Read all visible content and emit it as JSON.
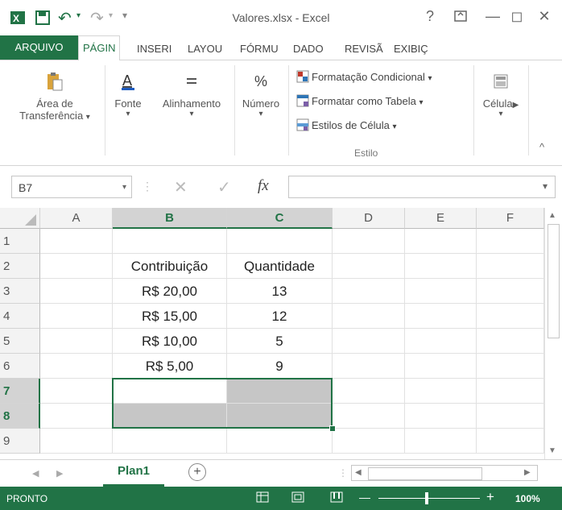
{
  "window": {
    "title": "Valores.xlsx - Excel",
    "help": "?",
    "minimize": "—",
    "maximize": "◻",
    "close": "✕"
  },
  "quick_access": {
    "save_icon": "save-icon",
    "undo_icon": "undo-icon",
    "redo_icon": "redo-icon",
    "customize": "▾"
  },
  "tabs": [
    "ARQUIVO",
    "PÁGIN",
    "INSERI",
    "LAYOU",
    "FÓRMU",
    "DADO",
    "REVISÃ",
    "EXIBIÇ"
  ],
  "ribbon": {
    "clipboard": {
      "line1": "Área de",
      "line2": "Transferência",
      "arrow": "▾"
    },
    "font": {
      "label": "Fonte",
      "arrow": "▾"
    },
    "alignment": {
      "label": "Alinhamento",
      "arrow": "▾"
    },
    "number": {
      "label": "Número",
      "arrow": "▾"
    },
    "styles": {
      "conditional": "Formatação Condicional",
      "table": "Formatar como Tabela",
      "cell_styles": "Estilos de Célula",
      "group_label": "Estilo"
    },
    "cells": {
      "label": "Célula",
      "arrow": "▾"
    },
    "collapse": "^"
  },
  "formula_bar": {
    "name_box": "B7",
    "cancel": "✕",
    "enter": "✓",
    "fx": "fx",
    "value": ""
  },
  "columns": [
    "A",
    "B",
    "C",
    "D",
    "E",
    "F"
  ],
  "rows": [
    "1",
    "2",
    "3",
    "4",
    "5",
    "6",
    "7",
    "8",
    "9"
  ],
  "cells": {
    "B2": "Contribuição",
    "C2": "Quantidade",
    "B3": "R$ 20,00",
    "C3": "13",
    "B4": "R$ 15,00",
    "C4": "12",
    "B5": "R$ 10,00",
    "C5": "5",
    "B6": "R$ 5,00",
    "C6": "9"
  },
  "selection": {
    "active_cell": "B7",
    "range": "B7:C8"
  },
  "sheets": {
    "active": "Plan1",
    "add": "+"
  },
  "status": {
    "ready": "PRONTO",
    "zoom": "100%",
    "minus": "—",
    "plus": "+"
  },
  "colors": {
    "accent": "#217346",
    "selection_fill": "#c6c6c6"
  }
}
